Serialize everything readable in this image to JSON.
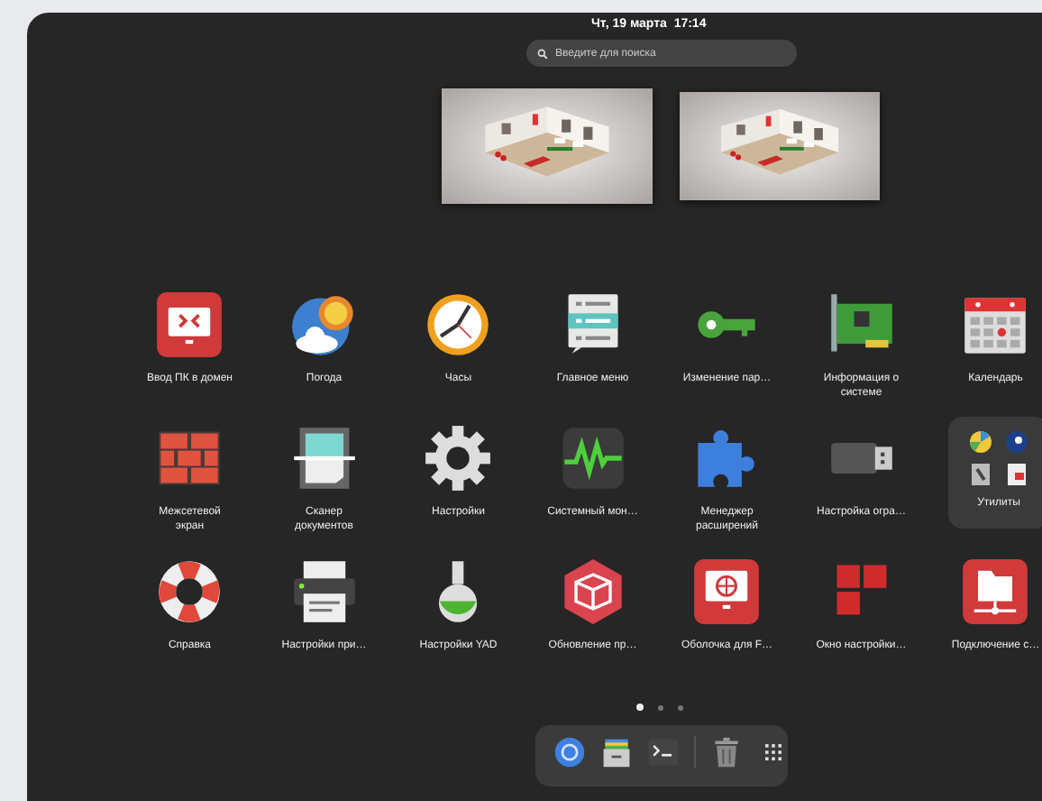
{
  "top_bar": {
    "clock": "Чт, 19 марта  17:14"
  },
  "search": {
    "placeholder": "Введите для поиска"
  },
  "apps": [
    {
      "label": "Ввод ПК в домен",
      "kind": "domain"
    },
    {
      "label": "Погода",
      "kind": "weather"
    },
    {
      "label": "Часы",
      "kind": "clock"
    },
    {
      "label": "Главное меню",
      "kind": "menu"
    },
    {
      "label": "Изменение пар…",
      "kind": "key"
    },
    {
      "label": "Информация о\nсистеме",
      "kind": "card"
    },
    {
      "label": "Календарь",
      "kind": "calendar"
    },
    {
      "label": "Межсетевой\nэкран",
      "kind": "firewall"
    },
    {
      "label": "Сканер\nдокументов",
      "kind": "scanner"
    },
    {
      "label": "Настройки",
      "kind": "gear"
    },
    {
      "label": "Системный мон…",
      "kind": "monitor"
    },
    {
      "label": "Менеджер\nрасширений",
      "kind": "puzzle"
    },
    {
      "label": "Настройка огра…",
      "kind": "usb"
    },
    {
      "label": "Утилиты",
      "kind": "folder"
    },
    {
      "label": "Справка",
      "kind": "lifebuoy"
    },
    {
      "label": "Настройки при…",
      "kind": "printer"
    },
    {
      "label": "Настройки YAD",
      "kind": "flask"
    },
    {
      "label": "Обновление пр…",
      "kind": "package"
    },
    {
      "label": "Оболочка для F…",
      "kind": "globe"
    },
    {
      "label": "Окно настройки…",
      "kind": "tiles"
    },
    {
      "label": "Подключение с…",
      "kind": "netfolder"
    }
  ],
  "pages": [
    {
      "selected": true
    },
    {
      "selected": false
    },
    {
      "selected": false
    }
  ],
  "dock": [
    {
      "kind": "browser"
    },
    {
      "kind": "files"
    },
    {
      "kind": "terminal"
    },
    {
      "kind": "separator"
    },
    {
      "kind": "trash"
    },
    {
      "kind": "grid"
    }
  ]
}
